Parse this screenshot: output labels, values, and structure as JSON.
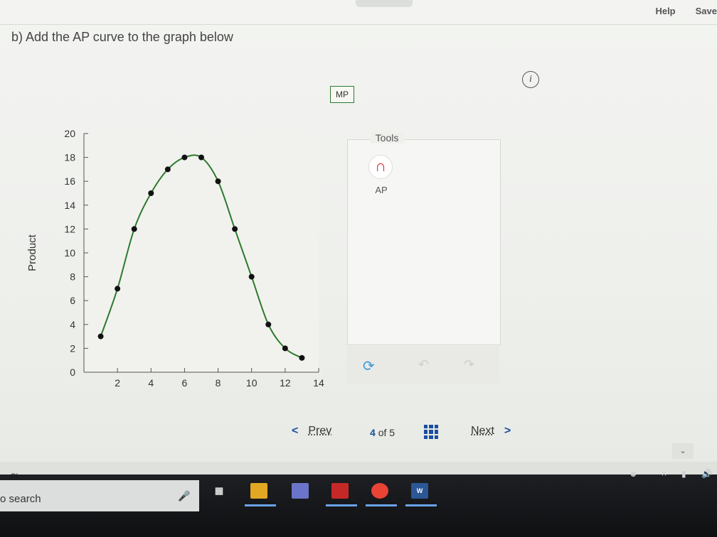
{
  "header": {
    "help_label": "Help",
    "save_label": "Save"
  },
  "question": {
    "text": "b) Add the AP curve to the graph below"
  },
  "info_label": "i",
  "mp_button_label": "MP",
  "tools": {
    "title": "Tools",
    "ap_label": "AP"
  },
  "nav": {
    "prev_label": "Prev",
    "current": "4",
    "of_label": "of",
    "total": "5",
    "next_label": "Next"
  },
  "taskbar": {
    "search_text": "o search",
    "corner_label": "C)"
  },
  "colors": {
    "curve": "#2d7a2d",
    "point": "#111111",
    "accent": "#1a4fa0"
  },
  "chart_data": {
    "type": "line",
    "title": "",
    "xlabel": "",
    "ylabel": "Product",
    "xlim": [
      0,
      14
    ],
    "ylim": [
      0,
      20
    ],
    "x_ticks": [
      2,
      4,
      6,
      8,
      10,
      12,
      14
    ],
    "y_ticks": [
      0,
      2,
      4,
      6,
      8,
      10,
      12,
      14,
      16,
      18,
      20
    ],
    "series": [
      {
        "name": "",
        "x": [
          1,
          2,
          3,
          4,
          5,
          6,
          7,
          8,
          9,
          10,
          11,
          12,
          13
        ],
        "values": [
          3,
          7,
          12,
          15,
          17,
          18,
          18,
          16,
          12,
          8,
          4,
          2,
          1.2
        ]
      }
    ]
  }
}
